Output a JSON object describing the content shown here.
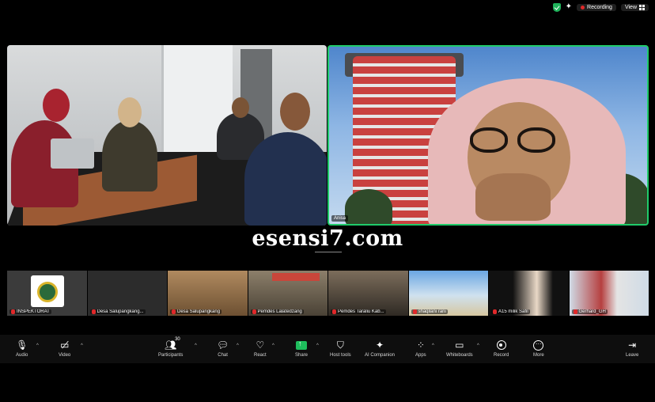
{
  "topbar": {
    "recording_label": "Recording",
    "view_label": "View"
  },
  "main_videos": [
    {
      "name": ""
    },
    {
      "name": "Anisa"
    }
  ],
  "watermark": "esensi7.com",
  "gallery": [
    {
      "name": "INSPEKTORAT"
    },
    {
      "name": "Desa Salupangkang..."
    },
    {
      "name": "Desa Salupangkang"
    },
    {
      "name": "Pemdes Lalatedzang"
    },
    {
      "name": "Pemdes Taraliu Kab..."
    },
    {
      "name": "shaqilani rani"
    },
    {
      "name": "A15 milik Safil"
    },
    {
      "name": "Gerhard_GH"
    }
  ],
  "toolbar": {
    "audio": "Audio",
    "video": "Video",
    "participants": "Participants",
    "participants_count": "30",
    "chat": "Chat",
    "react": "React",
    "share": "Share",
    "host_tools": "Host tools",
    "ai_companion": "AI Companion",
    "apps": "Apps",
    "whiteboards": "Whiteboards",
    "record": "Record",
    "more": "More",
    "leave": "Leave"
  },
  "colors": {
    "active_speaker_border": "#1fcb6a",
    "share_green": "#1ebd5c",
    "recording_red": "#e02828",
    "muted_red": "#f03a3a"
  }
}
